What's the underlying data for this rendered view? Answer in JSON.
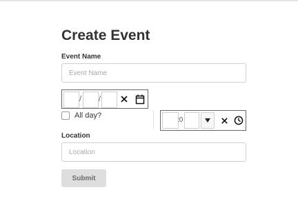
{
  "page": {
    "title": "Create Event"
  },
  "event_name": {
    "label": "Event Name",
    "value": "",
    "placeholder": "Event Name"
  },
  "date": {
    "separator": "/",
    "clear_icon": "close-icon",
    "calendar_icon": "calendar-icon"
  },
  "all_day": {
    "label": "All day?",
    "checked": false
  },
  "time": {
    "separator": ":0",
    "dropdown_icon": "triangle-down-icon",
    "clear_icon": "close-icon",
    "clock_icon": "clock-icon"
  },
  "location": {
    "label": "Location",
    "value": "",
    "placeholder": "Location"
  },
  "submit": {
    "label": "Submit"
  },
  "colors": {
    "text": "#333333",
    "input_border": "#cfcfcf",
    "picker_border": "#666666",
    "button_bg": "#dedede",
    "button_text": "#6b6b6b"
  }
}
